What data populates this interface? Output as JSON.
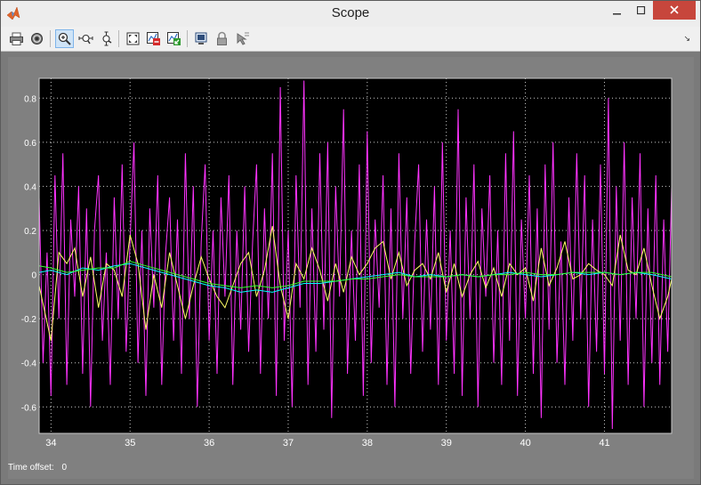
{
  "window": {
    "title": "Scope"
  },
  "toolbar": {
    "buttons": [
      {
        "name": "print",
        "icon": "printer-icon"
      },
      {
        "name": "parameters",
        "icon": "gear-icon"
      },
      {
        "name": "zoom",
        "icon": "zoom-in-icon",
        "active": true
      },
      {
        "name": "zoom-x",
        "icon": "zoom-x-icon"
      },
      {
        "name": "zoom-y",
        "icon": "zoom-y-icon"
      },
      {
        "name": "autoscale",
        "icon": "autoscale-icon"
      },
      {
        "name": "save-axes",
        "icon": "save-axes-icon"
      },
      {
        "name": "restore-axes",
        "icon": "restore-axes-icon"
      },
      {
        "name": "floating-scope",
        "icon": "floating-scope-icon"
      },
      {
        "name": "lock-axes",
        "icon": "lock-icon"
      },
      {
        "name": "signal-selection",
        "icon": "signal-selection-icon"
      }
    ]
  },
  "status": {
    "time_offset_label": "Time offset:",
    "time_offset_value": "0"
  },
  "chart_data": {
    "type": "line",
    "title": "",
    "xlabel": "",
    "ylabel": "",
    "xlim": [
      33.85,
      41.85
    ],
    "ylim": [
      -0.72,
      0.89
    ],
    "xticks": [
      34,
      35,
      36,
      37,
      38,
      39,
      40,
      41
    ],
    "yticks": [
      -0.6,
      -0.4,
      -0.2,
      0,
      0.2,
      0.4,
      0.6,
      0.8
    ],
    "ytick_labels": [
      "-0.6",
      "-0.4",
      "-0.2",
      "0",
      "0.2",
      "0.4",
      "0.6",
      "0.8"
    ],
    "grid": true,
    "colors": {
      "background": "#000000",
      "grid": "#ffffff",
      "tick_text": "#ffffff"
    },
    "series": [
      {
        "color": "#ff33ff",
        "x": [
          33.85,
          33.9,
          33.95,
          34.0,
          34.05,
          34.1,
          34.15,
          34.2,
          34.25,
          34.3,
          34.35,
          34.4,
          34.45,
          34.5,
          34.55,
          34.6,
          34.65,
          34.7,
          34.75,
          34.8,
          34.85,
          34.9,
          34.95,
          35.0,
          35.05,
          35.1,
          35.15,
          35.2,
          35.25,
          35.3,
          35.35,
          35.4,
          35.45,
          35.5,
          35.55,
          35.6,
          35.65,
          35.7,
          35.75,
          35.8,
          35.85,
          35.9,
          35.95,
          36.0,
          36.05,
          36.1,
          36.15,
          36.2,
          36.25,
          36.3,
          36.35,
          36.4,
          36.45,
          36.5,
          36.55,
          36.6,
          36.65,
          36.7,
          36.75,
          36.8,
          36.85,
          36.9,
          36.95,
          37.0,
          37.05,
          37.1,
          37.15,
          37.2,
          37.25,
          37.3,
          37.35,
          37.4,
          37.45,
          37.5,
          37.55,
          37.6,
          37.65,
          37.7,
          37.75,
          37.8,
          37.85,
          37.9,
          37.95,
          38.0,
          38.05,
          38.1,
          38.15,
          38.2,
          38.25,
          38.3,
          38.35,
          38.4,
          38.45,
          38.5,
          38.55,
          38.6,
          38.65,
          38.7,
          38.75,
          38.8,
          38.85,
          38.9,
          38.95,
          39.0,
          39.05,
          39.1,
          39.15,
          39.2,
          39.25,
          39.3,
          39.35,
          39.4,
          39.45,
          39.5,
          39.55,
          39.6,
          39.65,
          39.7,
          39.75,
          39.8,
          39.85,
          39.9,
          39.95,
          40.0,
          40.05,
          40.1,
          40.15,
          40.2,
          40.25,
          40.3,
          40.35,
          40.4,
          40.45,
          40.5,
          40.55,
          40.6,
          40.65,
          40.7,
          40.75,
          40.8,
          40.85,
          40.9,
          40.95,
          41.0,
          41.05,
          41.1,
          41.15,
          41.2,
          41.25,
          41.3,
          41.35,
          41.4,
          41.45,
          41.5,
          41.55,
          41.6,
          41.65,
          41.7,
          41.75,
          41.8,
          41.85
        ],
        "y": [
          0.35,
          -0.4,
          0.1,
          -0.55,
          0.45,
          -0.2,
          0.55,
          -0.5,
          0.25,
          -0.1,
          0.4,
          -0.45,
          0.3,
          -0.6,
          0.2,
          0.45,
          -0.3,
          0.1,
          -0.5,
          0.35,
          -0.2,
          0.5,
          -0.35,
          0.15,
          0.6,
          -0.4,
          0.2,
          -0.55,
          0.3,
          -0.15,
          0.45,
          -0.5,
          0.1,
          0.35,
          -0.3,
          0.25,
          -0.45,
          0.55,
          -0.2,
          0.4,
          -0.6,
          0.15,
          0.5,
          -0.3,
          0.2,
          -0.45,
          0.35,
          -0.1,
          0.45,
          -0.5,
          0.2,
          -0.25,
          0.4,
          -0.35,
          0.15,
          0.5,
          -0.45,
          0.3,
          -0.2,
          0.55,
          -0.55,
          0.85,
          -0.3,
          0.2,
          -0.6,
          0.45,
          -0.15,
          0.88,
          -0.5,
          0.3,
          -0.35,
          0.55,
          -0.25,
          0.6,
          -0.65,
          0.4,
          -0.1,
          0.75,
          -0.45,
          0.2,
          -0.3,
          0.5,
          -0.55,
          0.65,
          -0.4,
          0.25,
          -0.15,
          0.45,
          -0.5,
          0.3,
          -0.6,
          0.55,
          -0.2,
          0.35,
          -0.45,
          0.15,
          0.5,
          -0.35,
          0.25,
          -0.25,
          0.4,
          -0.5,
          0.6,
          -0.3,
          0.2,
          -0.45,
          0.75,
          -0.55,
          0.35,
          -0.2,
          0.5,
          -0.6,
          0.3,
          -0.1,
          0.45,
          -0.4,
          0.2,
          -0.5,
          0.55,
          -0.3,
          0.65,
          -0.55,
          0.25,
          -0.2,
          0.45,
          -0.45,
          0.3,
          -0.65,
          0.5,
          -0.25,
          0.6,
          -0.4,
          0.15,
          -0.5,
          0.35,
          -0.3,
          0.55,
          -0.2,
          0.45,
          -0.6,
          0.25,
          -0.35,
          0.5,
          -0.45,
          0.8,
          -0.7,
          0.4,
          -0.3,
          0.6,
          -0.5,
          0.35,
          -0.2,
          0.55,
          -0.6,
          0.3,
          -0.4,
          0.45,
          -0.5,
          0.25,
          -0.35,
          0.4
        ]
      },
      {
        "color": "#ffff66",
        "x": [
          33.85,
          34.0,
          34.1,
          34.2,
          34.3,
          34.4,
          34.5,
          34.6,
          34.7,
          34.8,
          34.9,
          35.0,
          35.1,
          35.2,
          35.3,
          35.4,
          35.5,
          35.6,
          35.7,
          35.8,
          35.9,
          36.0,
          36.1,
          36.2,
          36.3,
          36.4,
          36.5,
          36.6,
          36.7,
          36.8,
          36.9,
          37.0,
          37.1,
          37.2,
          37.3,
          37.4,
          37.5,
          37.6,
          37.7,
          37.8,
          37.9,
          38.0,
          38.1,
          38.2,
          38.3,
          38.4,
          38.5,
          38.6,
          38.7,
          38.8,
          38.9,
          39.0,
          39.1,
          39.2,
          39.3,
          39.4,
          39.5,
          39.6,
          39.7,
          39.8,
          39.9,
          40.0,
          40.1,
          40.2,
          40.3,
          40.4,
          40.5,
          40.6,
          40.7,
          40.8,
          40.9,
          41.0,
          41.1,
          41.2,
          41.3,
          41.4,
          41.5,
          41.6,
          41.7,
          41.8,
          41.85
        ],
        "y": [
          -0.05,
          -0.3,
          0.1,
          0.05,
          0.12,
          -0.1,
          0.08,
          -0.15,
          0.05,
          0.02,
          -0.1,
          0.18,
          0.05,
          -0.25,
          0.0,
          -0.15,
          0.1,
          -0.05,
          -0.2,
          -0.05,
          0.08,
          -0.02,
          -0.1,
          -0.15,
          -0.05,
          0.05,
          0.1,
          -0.1,
          0.02,
          0.22,
          -0.05,
          -0.2,
          0.05,
          -0.02,
          0.12,
          0.02,
          -0.12,
          0.05,
          -0.08,
          0.08,
          0.0,
          0.05,
          0.12,
          0.15,
          -0.02,
          0.1,
          -0.05,
          0.02,
          0.05,
          -0.02,
          0.1,
          -0.08,
          0.05,
          -0.1,
          0.0,
          0.06,
          -0.06,
          0.03,
          -0.1,
          0.05,
          0.0,
          0.03,
          -0.12,
          0.12,
          -0.05,
          0.03,
          0.15,
          -0.02,
          0.0,
          0.05,
          0.02,
          0.0,
          -0.05,
          0.18,
          0.02,
          0.0,
          0.12,
          -0.05,
          -0.2,
          -0.1,
          -0.02
        ]
      },
      {
        "color": "#00ffff",
        "x": [
          33.85,
          34.0,
          34.2,
          34.4,
          34.6,
          34.8,
          35.0,
          35.2,
          35.4,
          35.6,
          35.8,
          36.0,
          36.2,
          36.4,
          36.6,
          36.8,
          37.0,
          37.2,
          37.4,
          37.6,
          37.8,
          38.0,
          38.2,
          38.4,
          38.6,
          38.8,
          39.0,
          39.2,
          39.4,
          39.6,
          39.8,
          40.0,
          40.2,
          40.4,
          40.6,
          40.8,
          41.0,
          41.2,
          41.4,
          41.6,
          41.85
        ],
        "y": [
          0.01,
          0.02,
          0.0,
          0.03,
          0.02,
          0.04,
          0.05,
          0.03,
          0.01,
          -0.01,
          -0.03,
          -0.05,
          -0.06,
          -0.08,
          -0.07,
          -0.08,
          -0.06,
          -0.04,
          -0.04,
          -0.03,
          -0.02,
          -0.01,
          0.0,
          0.01,
          -0.01,
          0.0,
          -0.01,
          0.0,
          -0.01,
          0.0,
          0.01,
          0.0,
          -0.01,
          0.0,
          0.01,
          0.0,
          0.01,
          0.0,
          0.01,
          0.0,
          -0.02
        ]
      },
      {
        "color": "#33ff33",
        "x": [
          33.85,
          34.0,
          34.2,
          34.4,
          34.6,
          34.8,
          35.0,
          35.2,
          35.4,
          35.6,
          35.8,
          36.0,
          36.2,
          36.4,
          36.6,
          36.8,
          37.0,
          37.2,
          37.4,
          37.6,
          37.8,
          38.0,
          38.2,
          38.4,
          38.6,
          38.8,
          39.0,
          39.2,
          39.4,
          39.6,
          39.8,
          40.0,
          40.2,
          40.4,
          40.6,
          40.8,
          41.0,
          41.2,
          41.4,
          41.6,
          41.85
        ],
        "y": [
          0.04,
          0.03,
          0.01,
          0.02,
          0.03,
          0.03,
          0.06,
          0.04,
          0.02,
          0.0,
          -0.02,
          -0.04,
          -0.05,
          -0.06,
          -0.05,
          -0.06,
          -0.05,
          -0.03,
          -0.03,
          -0.03,
          -0.02,
          -0.02,
          -0.01,
          0.0,
          -0.01,
          -0.01,
          -0.01,
          0.0,
          -0.01,
          0.0,
          0.0,
          0.01,
          0.0,
          0.0,
          0.01,
          0.01,
          0.01,
          0.0,
          0.01,
          0.01,
          -0.01
        ]
      }
    ]
  }
}
